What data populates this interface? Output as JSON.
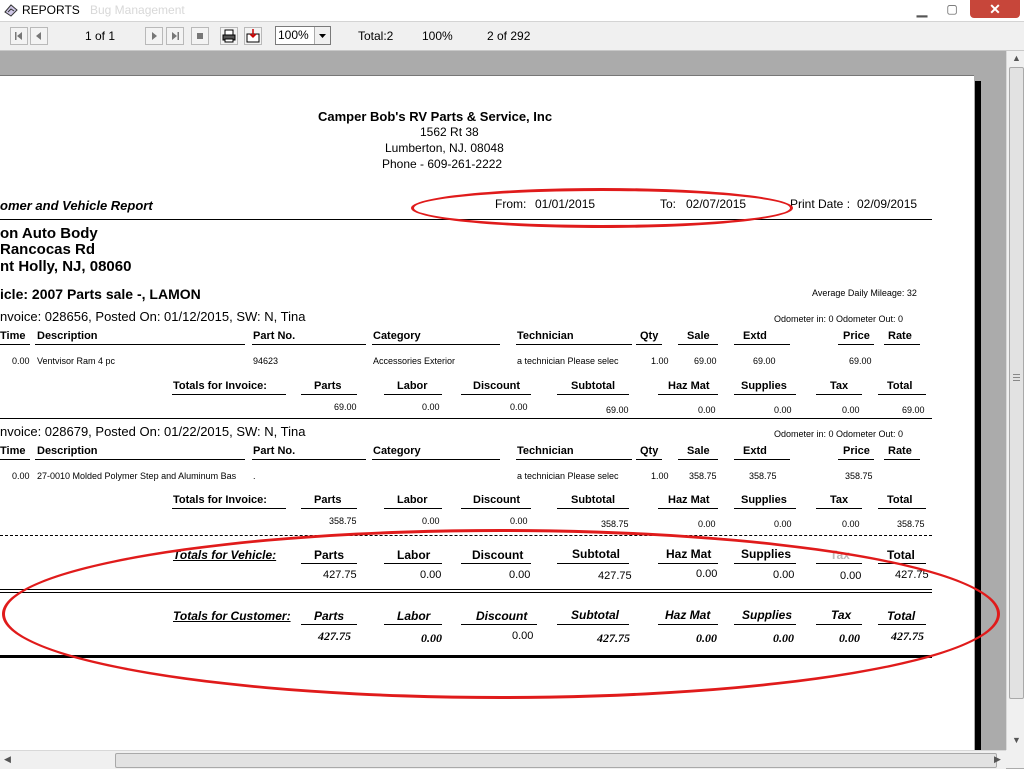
{
  "window": {
    "title": "REPORTS",
    "ghost_title": "Bug Management",
    "close_glyph": "✕",
    "min_glyph": "▁",
    "max_glyph": "▢"
  },
  "toolbar": {
    "page_indicator": "1 of 1",
    "zoom_value": "100%",
    "total": "Total:2",
    "percent": "100%",
    "record_pos": "2 of 292",
    "icons": [
      "first-page-icon",
      "prev-page-icon",
      "next-page-icon",
      "last-page-icon",
      "stop-icon",
      "print-icon",
      "export-icon",
      "dropdown-arrow-icon"
    ]
  },
  "report": {
    "company": "Camper Bob's RV Parts & Service, Inc",
    "address1": "1562 Rt 38",
    "address2": "Lumberton, NJ.  08048",
    "phone": "Phone - 609-261-2222",
    "report_title": "omer and Vehicle Report",
    "from_label": "From:",
    "from_date": "01/01/2015",
    "to_label": "To:",
    "to_date": "02/07/2015",
    "print_label": "Print Date :",
    "print_date": "02/09/2015",
    "customer_line1": "on Auto Body",
    "customer_line2": "Rancocas Rd",
    "customer_line3": "nt Holly, NJ, 08060",
    "vehicle_line": "icle: 2007 Parts sale -, LAMON",
    "avg_mileage": "Average Daily Mileage:  32",
    "annotation_color": "#e01b1b",
    "col_headers": {
      "time": "Time",
      "description": "Description",
      "part_no": "Part No.",
      "category": "Category",
      "technician": "Technician",
      "qty": "Qty",
      "sale": "Sale",
      "extd": "Extd",
      "price": "Price",
      "rate": "Rate"
    },
    "totals_headers": {
      "parts": "Parts",
      "labor": "Labor",
      "discount": "Discount",
      "subtotal": "Subtotal",
      "haz_mat": "Haz Mat",
      "supplies": "Supplies",
      "tax": "Tax",
      "total": "Total"
    },
    "invoice_totals_label": "Totals for Invoice:",
    "invoices": [
      {
        "header": "nvoice: 028656,   Posted On:  01/12/2015,   SW: N, Tina",
        "odometer": "Odometer in:  0    Odometer Out:  0",
        "line": {
          "time": "0.00",
          "description": "Ventvisor Ram 4 pc",
          "part_no": "94623",
          "category": "Accessories Exterior",
          "technician": "a technician Please selec",
          "qty": "1.00",
          "sale": "69.00",
          "extd": "69.00",
          "price": "69.00"
        },
        "totals": {
          "parts": "69.00",
          "labor": "0.00",
          "discount": "0.00",
          "subtotal": "69.00",
          "haz_mat": "0.00",
          "supplies": "0.00",
          "tax": "0.00",
          "total": "69.00"
        }
      },
      {
        "header": "nvoice: 028679,   Posted On:  01/22/2015,   SW: N, Tina",
        "odometer": "Odometer in:  0    Odometer Out:  0",
        "line": {
          "time": "0.00",
          "description": "27-0010  Molded Polymer Step and Aluminum Bas",
          "part_no": ".",
          "category": "",
          "technician": "a technician Please selec",
          "qty": "1.00",
          "sale": "358.75",
          "extd": "358.75",
          "price": "358.75"
        },
        "totals": {
          "parts": "358.75",
          "labor": "0.00",
          "discount": "0.00",
          "subtotal": "358.75",
          "haz_mat": "0.00",
          "supplies": "0.00",
          "tax": "0.00",
          "total": "358.75"
        }
      }
    ],
    "vehicle_totals": {
      "label": "Totals for Vehicle:",
      "parts": "427.75",
      "labor": "0.00",
      "discount": "0.00",
      "subtotal": "427.75",
      "haz_mat": "0.00",
      "supplies": "0.00",
      "tax_header": "Tax",
      "tax": "0.00",
      "total": "427.75"
    },
    "customer_totals": {
      "label": "Totals for Customer:",
      "parts": "427.75",
      "labor": "0.00",
      "discount": "0.00",
      "subtotal": "427.75",
      "haz_mat": "0.00",
      "supplies": "0.00",
      "tax": "0.00",
      "total": "427.75"
    }
  }
}
